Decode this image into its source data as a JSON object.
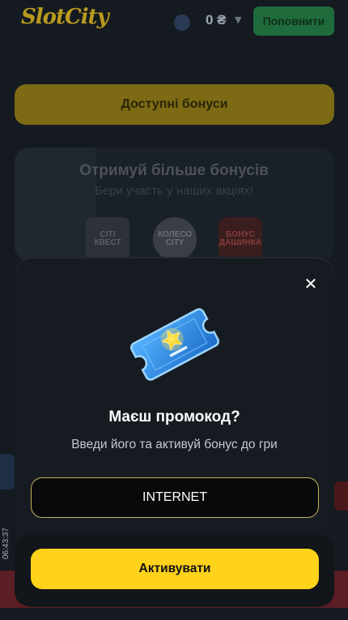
{
  "header": {
    "logo_text": "SlotCity",
    "balance": "0 ₴",
    "deposit_label": "Поповнити"
  },
  "bonuses_button_label": "Доступні бонуси",
  "promo_section": {
    "title": "Отримуй більше бонусів",
    "subtitle": "Бери участь у наших акціях!",
    "badges": [
      "CITI КВЕСТ",
      "КОЛЕСО CITY",
      "БОНУС ДАШИНКА"
    ]
  },
  "side_clock": "06:43:37",
  "modal": {
    "title": "Маєш промокод?",
    "description": "Введи його та активуй бонус до гри",
    "promo_input_value": "INTERNET",
    "activate_label": "Активувати",
    "close_icon": "close-icon",
    "ticket_icon": "promo-ticket-icon"
  },
  "colors": {
    "accent_yellow": "#ffd21c",
    "input_border": "#c9b25a",
    "modal_bg": "#161b21",
    "ticket_blue": "#2f8fe0"
  }
}
